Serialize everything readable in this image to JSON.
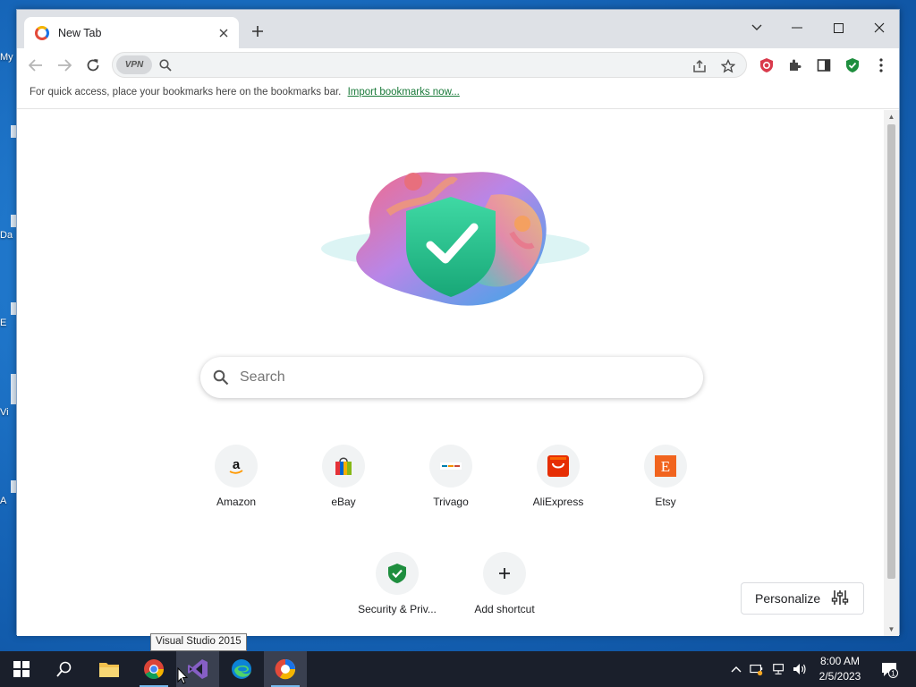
{
  "desktop": {
    "icons": [
      {
        "label": "My",
        "name": "desktop-icon-my"
      },
      {
        "label": "Da",
        "name": "desktop-icon-da"
      },
      {
        "label": "E",
        "name": "desktop-icon-e"
      },
      {
        "label": "Vi",
        "name": "desktop-icon-vi"
      },
      {
        "label": "A",
        "name": "desktop-icon-a"
      }
    ]
  },
  "browser": {
    "tab": {
      "title": "New Tab"
    },
    "omnibox": {
      "vpn_label": "VPN",
      "value": "",
      "placeholder": ""
    },
    "bookmarks_bar": {
      "text": "For quick access, place your bookmarks here on the bookmarks bar.",
      "link": "Import bookmarks now..."
    },
    "ntp": {
      "search_placeholder": "Search",
      "shortcuts": [
        {
          "label": "Amazon",
          "icon": "amazon-icon"
        },
        {
          "label": "eBay",
          "icon": "ebay-icon"
        },
        {
          "label": "Trivago",
          "icon": "trivago-icon"
        },
        {
          "label": "AliExpress",
          "icon": "aliexpress-icon"
        },
        {
          "label": "Etsy",
          "icon": "etsy-icon"
        },
        {
          "label": "Security & Priv...",
          "icon": "security-shield-icon"
        },
        {
          "label": "Add shortcut",
          "icon": "plus-icon"
        }
      ],
      "personalize_label": "Personalize"
    }
  },
  "tooltip": {
    "text": "Visual Studio 2015"
  },
  "taskbar": {
    "apps": [
      "start-button",
      "search-button",
      "file-explorer",
      "chrome",
      "visual-studio",
      "edge",
      "avast-secure-browser"
    ],
    "clock": {
      "time": "8:00 AM",
      "date": "2/5/2023"
    },
    "notification_count": "1"
  },
  "colors": {
    "accent": "#1a73e8",
    "taskbar": "#1a1f2b",
    "shield_green": "#1e8e3e"
  }
}
